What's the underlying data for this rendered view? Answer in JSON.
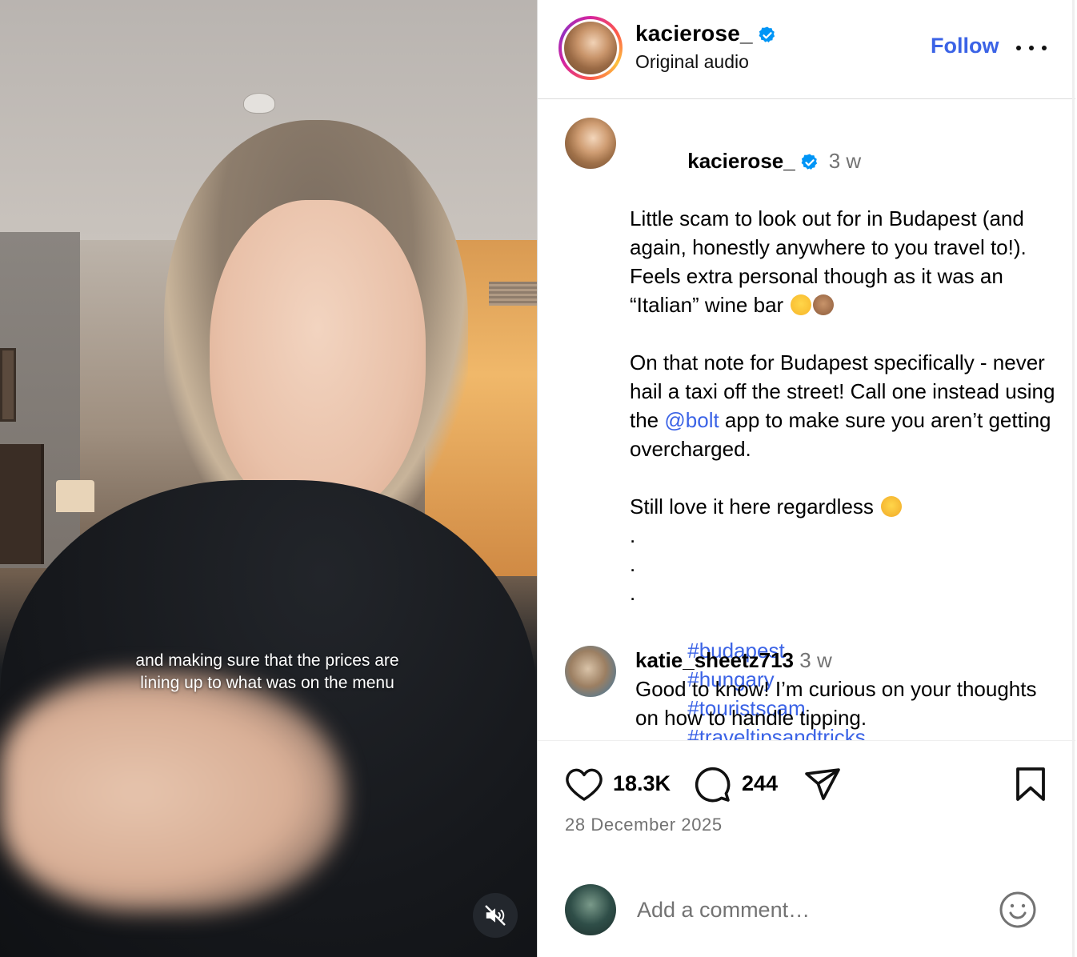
{
  "video": {
    "caption": "and making sure that the prices are lining up to what was on the menu",
    "mute_icon": "speaker-muted-icon"
  },
  "header": {
    "username": "kacierose_",
    "verified_icon": "verified-badge-icon",
    "audio": "Original audio",
    "follow_label": "Follow",
    "more_icon": "more-options-icon"
  },
  "post": {
    "username": "kacierose_",
    "time": "3 w",
    "paragraph1": "Little scam to look out for in Budapest (and again, honestly anywhere to you travel to!). Feels extra personal though as it was an “Italian” wine bar",
    "paragraph2_before": "On that note for Budapest specifically - never hail a taxi off the street! Call one instead using the ",
    "mention": "@bolt",
    "paragraph2_after": " app to make sure you aren’t getting overcharged.",
    "paragraph3": "Still love it here regardless",
    "dots": ".\n.\n.",
    "hashtags": [
      "#budapest",
      "#hungary",
      "#touristscam",
      "#traveltipsandtricks"
    ]
  },
  "comment": {
    "username": "katie_sheetz713",
    "time": "3 w",
    "text": "Good to know! I’m curious on your thoughts on how to handle tipping."
  },
  "actions": {
    "likes": "18.3K",
    "comments": "244",
    "date": "28 December 2025"
  },
  "add_comment": {
    "placeholder": "Add a comment…"
  },
  "colors": {
    "link": "#3b63e6",
    "secondary_text": "#737373",
    "verified": "#0095f6"
  }
}
